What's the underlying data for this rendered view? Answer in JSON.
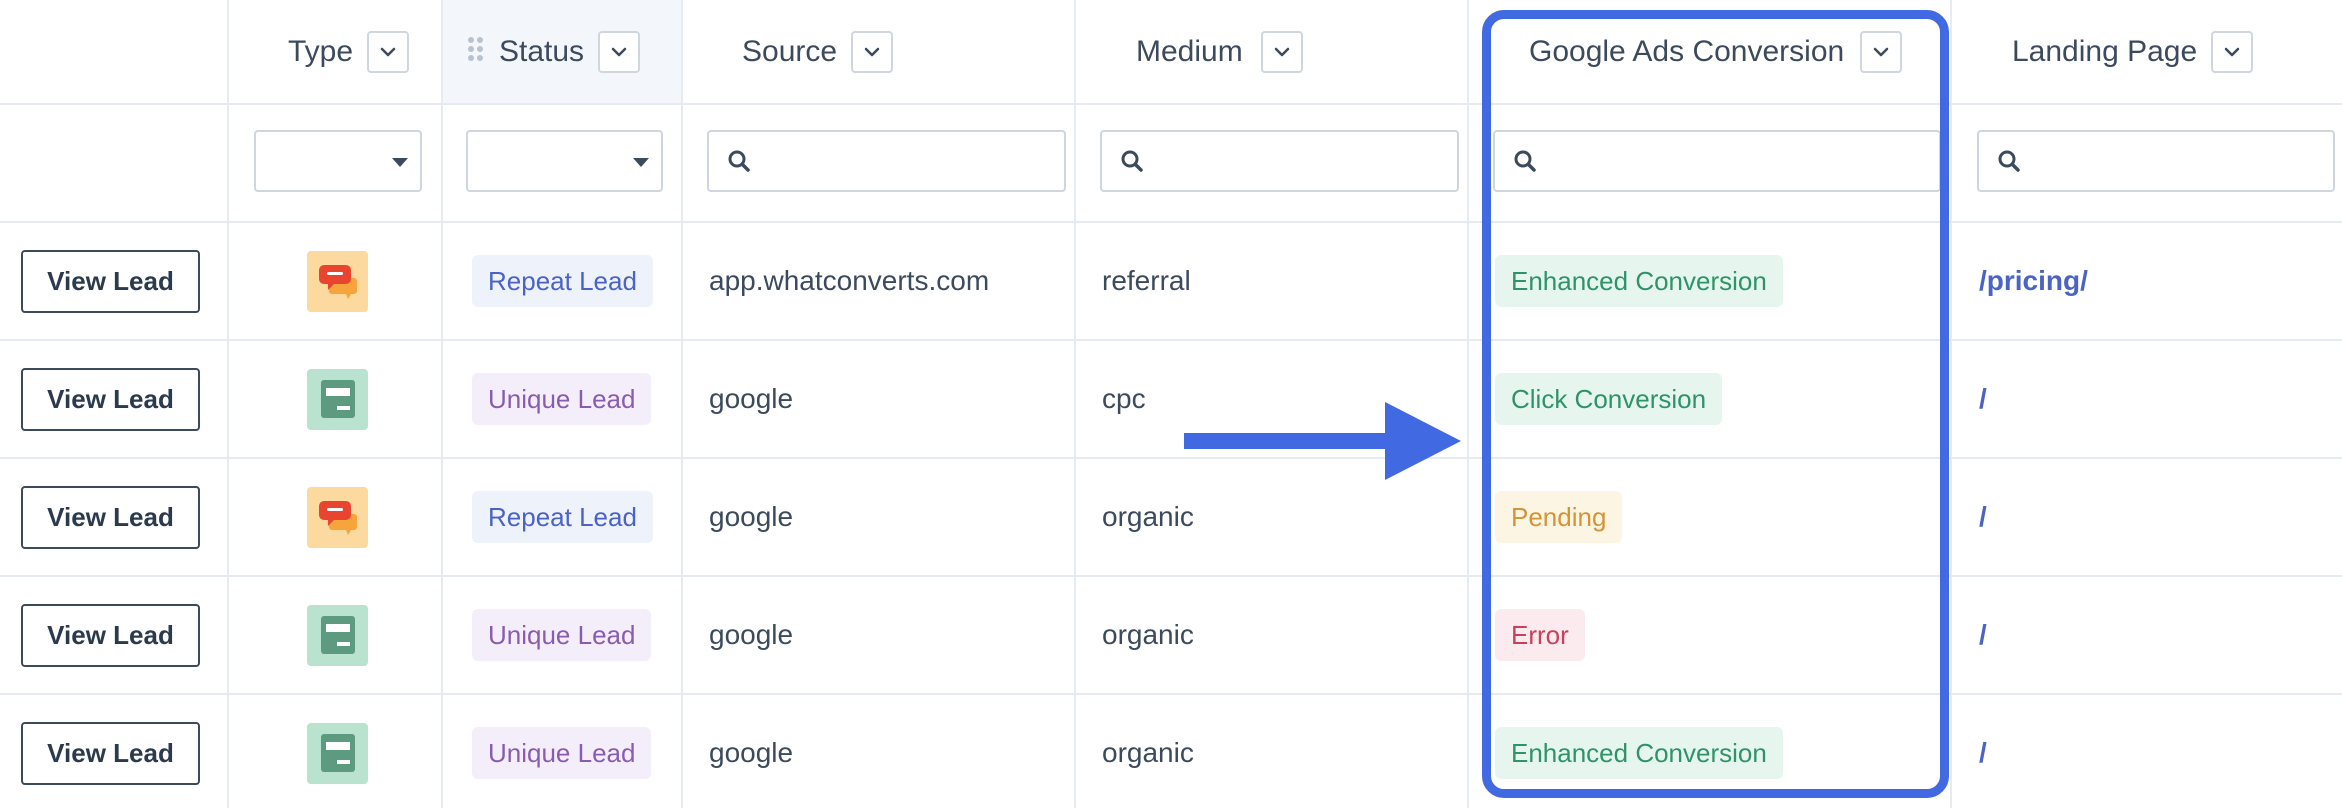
{
  "headers": {
    "type": "Type",
    "status": "Status",
    "source": "Source",
    "medium": "Medium",
    "google_ads": "Google Ads Conversion",
    "landing": "Landing Page"
  },
  "colors": {
    "accent": "#4169e1",
    "repeat_lead_text": "#4a63c4",
    "repeat_lead_bg": "#eef2fb",
    "unique_lead_text": "#8a5cb0",
    "unique_lead_bg": "#f4eefa",
    "enhanced_text": "#2e9467",
    "enhanced_bg": "#e6f6ee",
    "pending_text": "#d49434",
    "pending_bg": "#fdf5e4",
    "error_text": "#c9405a",
    "error_bg": "#fbeaee"
  },
  "rows": [
    {
      "button": "View Lead",
      "type_icon": "chat-icon",
      "status": "Repeat Lead",
      "status_kind": "repeat",
      "source": "app.whatconverts.com",
      "medium": "referral",
      "conversion": "Enhanced Conversion",
      "conversion_kind": "success",
      "landing": "/pricing/"
    },
    {
      "button": "View Lead",
      "type_icon": "form-icon",
      "status": "Unique Lead",
      "status_kind": "unique",
      "source": "google",
      "medium": "cpc",
      "conversion": "Click Conversion",
      "conversion_kind": "success",
      "landing": "/"
    },
    {
      "button": "View Lead",
      "type_icon": "chat-icon",
      "status": "Repeat Lead",
      "status_kind": "repeat",
      "source": "google",
      "medium": "organic",
      "conversion": "Pending",
      "conversion_kind": "pending",
      "landing": "/"
    },
    {
      "button": "View Lead",
      "type_icon": "form-icon",
      "status": "Unique Lead",
      "status_kind": "unique",
      "source": "google",
      "medium": "organic",
      "conversion": "Error",
      "conversion_kind": "error",
      "landing": "/"
    },
    {
      "button": "View Lead",
      "type_icon": "form-icon",
      "status": "Unique Lead",
      "status_kind": "unique",
      "source": "google",
      "medium": "organic",
      "conversion": "Enhanced Conversion",
      "conversion_kind": "success",
      "landing": "/"
    }
  ]
}
